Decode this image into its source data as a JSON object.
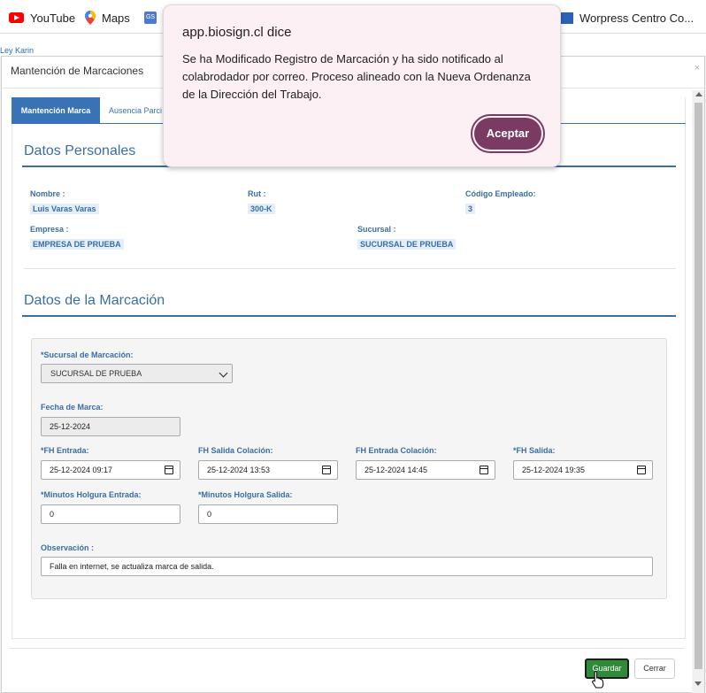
{
  "bookmarks": [
    {
      "label": "YouTube",
      "icon": "youtube-icon"
    },
    {
      "label": "Maps",
      "icon": "maps-icon"
    },
    {
      "label": "",
      "icon": "gs-icon"
    },
    {
      "label": "Worpress Centro Co...",
      "icon": "wordpress-icon"
    }
  ],
  "background_link": "Ley Karin",
  "modal": {
    "title": "Mantención de Marcaciones",
    "close": "×",
    "tabs": [
      "Mantención Marca",
      "Ausencia Parci"
    ]
  },
  "personal": {
    "section_title": "Datos Personales",
    "nombre_label": "Nombre :",
    "nombre_value": "Luis Varas Varas",
    "rut_label": "Rut :",
    "rut_value": "300-K",
    "codigo_label": "Código Empleado:",
    "codigo_value": "3",
    "empresa_label": "Empresa :",
    "empresa_value": "EMPRESA DE PRUEBA",
    "sucursal_label": "Sucursal :",
    "sucursal_value": "SUCURSAL DE PRUEBA"
  },
  "marcacion": {
    "section_title": "Datos de la Marcación",
    "sucursal_label": "*Sucursal de Marcación:",
    "sucursal_value": "SUCURSAL DE PRUEBA",
    "fecha_label": "Fecha de Marca:",
    "fecha_value": "25-12-2024",
    "fh_entrada_label": "*FH Entrada:",
    "fh_entrada_value": "25-12-2024 09:17",
    "fh_salida_colacion_label": "FH Salida Colación:",
    "fh_salida_colacion_value": "25-12-2024 13:53",
    "fh_entrada_colacion_label": "FH Entrada Colación:",
    "fh_entrada_colacion_value": "25-12-2024 14:45",
    "fh_salida_label": "*FH Salida:",
    "fh_salida_value": "25-12-2024 19:35",
    "holgura_entrada_label": "*Minutos Holgura Entrada:",
    "holgura_entrada_value": "0",
    "holgura_salida_label": "*Minutos Holgura Salida:",
    "holgura_salida_value": "0",
    "observacion_label": "Observación :",
    "observacion_value": "Falla en internet, se actualiza marca de salida."
  },
  "footer": {
    "guardar": "Guardar",
    "cerrar": "Cerrar"
  },
  "alert": {
    "title": "app.biosign.cl dice",
    "message": "Se ha Modificado Registro de Marcación y ha sido notificado al colabrodador por correo. Proceso alineado con la Nueva Ordenanza de la Dirección del Trabajo.",
    "button": "Aceptar",
    "accent_color": "#7a3a62"
  }
}
